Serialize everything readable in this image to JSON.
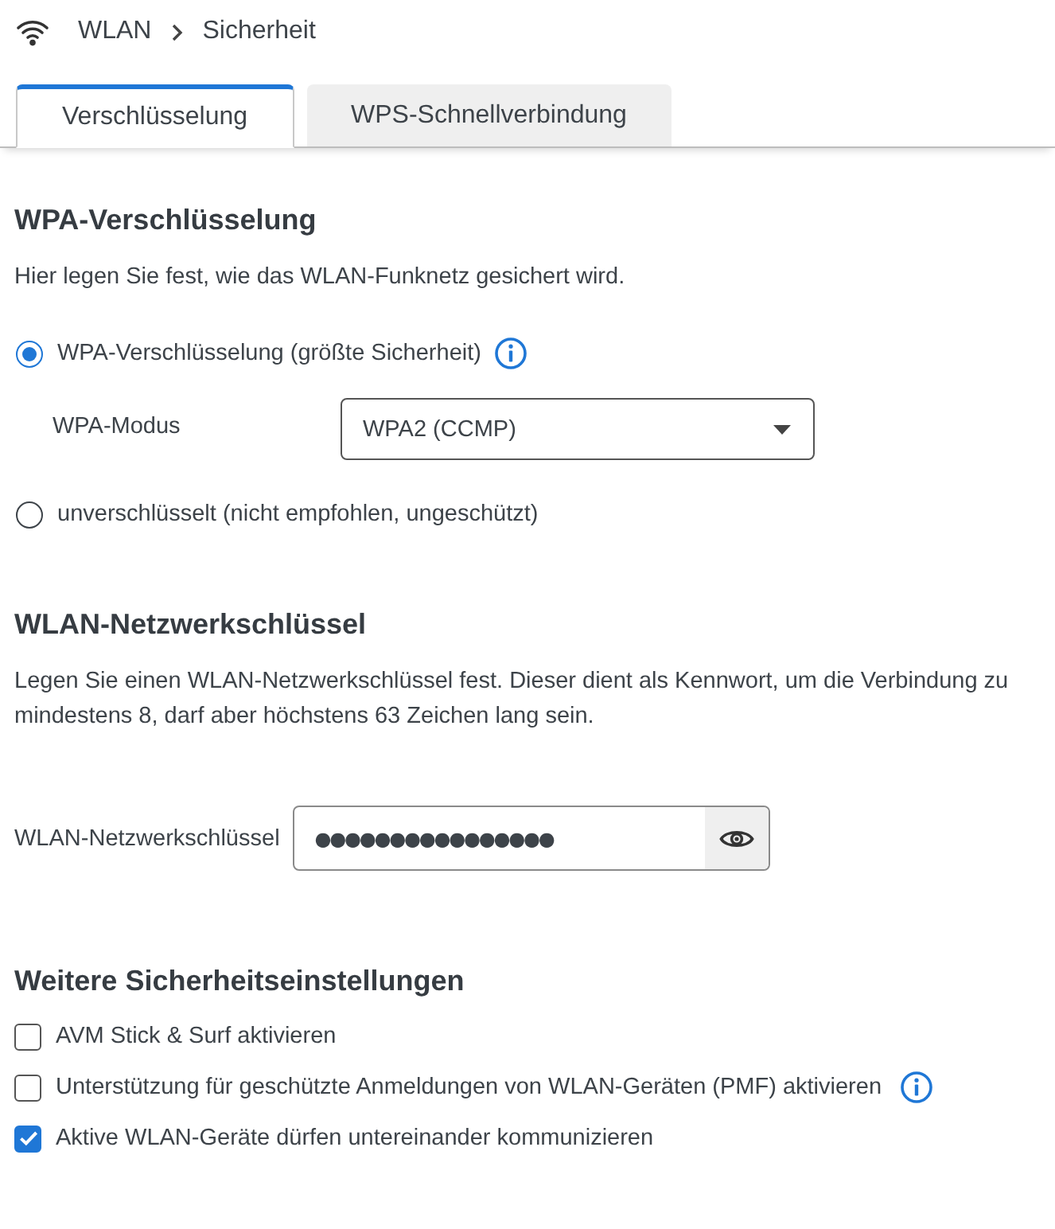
{
  "breadcrumb": {
    "items": [
      {
        "label": "WLAN"
      },
      {
        "label": "Sicherheit"
      }
    ]
  },
  "tabs": [
    {
      "label": "Verschlüsselung",
      "selected": true
    },
    {
      "label": "WPS-Schnellverbindung",
      "selected": false
    }
  ],
  "sections": [
    {
      "title": "WPA-Verschlüsselung",
      "description": [
        "Hier legen Sie fest, wie das WLAN-Funknetz gesichert wird."
      ],
      "items": [
        {
          "kind": "radio",
          "label": "WPA-Verschlüsselung (größte Sicherheit)",
          "selected": true,
          "info": true
        },
        {
          "kind": "select",
          "label": "WPA-Modus",
          "value": "WPA2 (CCMP)"
        },
        {
          "kind": "radio",
          "label": "unverschlüsselt (nicht empfohlen, ungeschützt)",
          "selected": false,
          "info": false
        }
      ]
    },
    {
      "title": "WLAN-Netzwerkschlüssel",
      "description": [
        "Legen Sie einen WLAN-Netzwerkschlüssel fest. Dieser dient als Kennwort, um die Verbindung zu",
        "mindestens 8, darf aber höchstens 63 Zeichen lang sein."
      ],
      "items": [
        {
          "kind": "password",
          "label": "WLAN-Netzwerkschlüssel",
          "value": "●●●●●●●●●●●●●●●●"
        }
      ]
    },
    {
      "title": "Weitere Sicherheitseinstellungen",
      "items": [
        {
          "kind": "checkbox",
          "label": "AVM Stick & Surf aktivieren",
          "checked": false,
          "info": false
        },
        {
          "kind": "checkbox",
          "label": "Unterstützung für geschützte Anmeldungen von WLAN-Geräten (PMF) aktivieren",
          "checked": false,
          "info": true
        },
        {
          "kind": "checkbox",
          "label": "Aktive WLAN-Geräte dürfen untereinander kommunizieren",
          "checked": true,
          "info": false
        }
      ]
    }
  ]
}
